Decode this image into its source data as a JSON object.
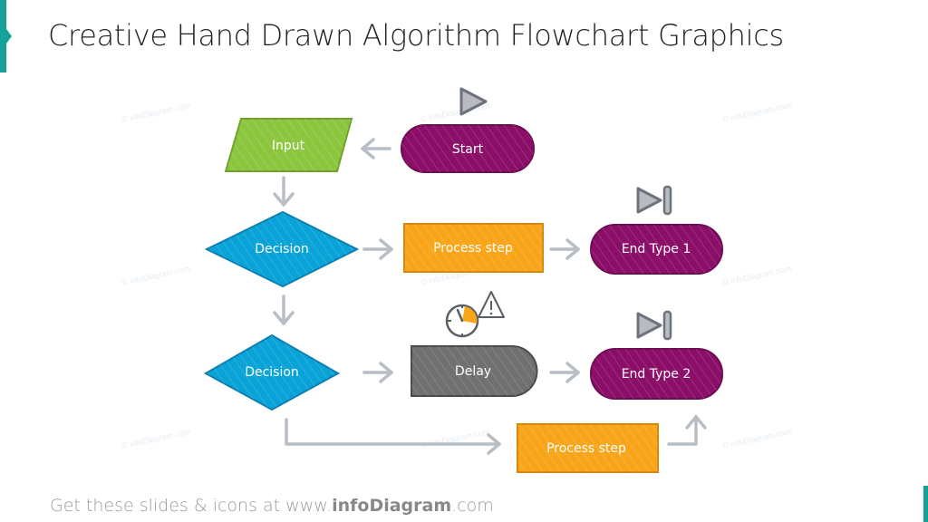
{
  "title": "Creative Hand Drawn Algorithm Flowchart Graphics",
  "footer": {
    "prefix": "Get these slides & icons at www.",
    "brand": "infoDiagram",
    "suffix": ".com"
  },
  "colors": {
    "accent": "#16a29b",
    "input": "#8cc63f",
    "decision": "#0aa3d8",
    "process": "#f9a51a",
    "terminal": "#8b0e68",
    "delay": "#707070",
    "arrow": "#b8bec6",
    "icon": "#9aa0a8"
  },
  "watermark": "© infoDiagram.com",
  "nodes": {
    "start": {
      "label": "Start",
      "icon": "play-icon"
    },
    "input": {
      "label": "Input"
    },
    "decision1": {
      "label": "Decision"
    },
    "process1": {
      "label": "Process step"
    },
    "end1": {
      "label": "End Type 1",
      "icon": "skip-forward-icon"
    },
    "decision2": {
      "label": "Decision"
    },
    "delay": {
      "label": "Delay",
      "icon": "stopwatch-warning-icon"
    },
    "end2": {
      "label": "End Type 2",
      "icon": "skip-forward-icon"
    },
    "process2": {
      "label": "Process step"
    }
  }
}
